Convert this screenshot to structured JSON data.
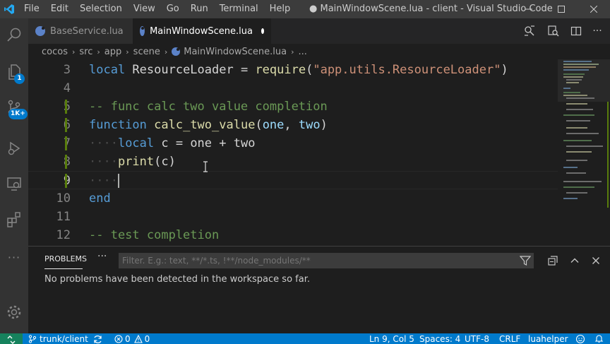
{
  "menu": [
    "File",
    "Edit",
    "Selection",
    "View",
    "Go",
    "Run",
    "Terminal",
    "Help"
  ],
  "window_title": "● MainWindowScene.lua - client - Visual Studio Code",
  "activity": {
    "source_control_badge": "1",
    "extensions_badge": "1K+"
  },
  "tabs": [
    {
      "label": "BaseService.lua",
      "active": false
    },
    {
      "label": "MainWindowScene.lua",
      "active": true,
      "dirty": true
    }
  ],
  "breadcrumb": [
    "cocos",
    "src",
    "app",
    "scene",
    "MainWindowScene.lua",
    "..."
  ],
  "editor": {
    "line_numbers": [
      "3",
      "4",
      "5",
      "6",
      "7",
      "8",
      "9",
      "10",
      "11",
      "12"
    ],
    "current_line": "9",
    "lines": {
      "l3": {
        "kw": "local",
        "name": " ResourceLoader ",
        "op": "= ",
        "fn": "require",
        "open": "(",
        "str": "\"app.utils.ResourceLoader\"",
        "close": ")"
      },
      "l5": {
        "comment": "-- func calc two value completion"
      },
      "l6": {
        "kw": "function",
        "fn": "calc_two_value",
        "open": "(",
        "p1": "one",
        "comma": ", ",
        "p2": "two",
        "close": ")"
      },
      "l7": {
        "ws": "····",
        "kw": "local",
        "rest": " c = one + two"
      },
      "l8": {
        "ws": "····",
        "fn": "print",
        "rest": "(c)"
      },
      "l9": {
        "ws": "····"
      },
      "l10": {
        "kw": "end"
      },
      "l12": {
        "comment": "-- test completion"
      }
    }
  },
  "panel": {
    "tab": "PROBLEMS",
    "more": "···",
    "filter_placeholder": "Filter. E.g.: text, **/*.ts, !**/node_modules/**",
    "message": "No problems have been detected in the workspace so far."
  },
  "status": {
    "branch": "trunk/client",
    "errors": "0",
    "warnings": "0",
    "position": "Ln 9, Col 5",
    "spaces": "Spaces: 4",
    "encoding": "UTF-8",
    "eol": "CRLF",
    "language": "luahelper"
  },
  "colors": {
    "accent": "#007acc",
    "remote": "#16825d",
    "keyword": "#569cd6",
    "function": "#dcdcaa",
    "string": "#ce9178",
    "comment": "#6a9955"
  }
}
